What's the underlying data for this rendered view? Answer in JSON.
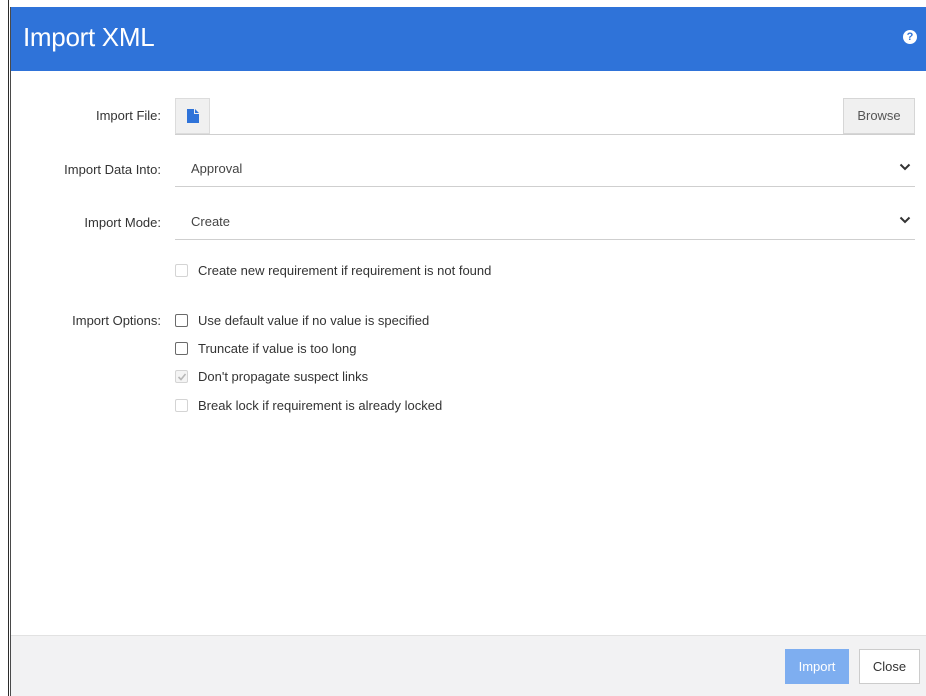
{
  "dialog": {
    "title": "Import XML",
    "help_icon": "question-circle-icon",
    "help_glyph": "?"
  },
  "colors": {
    "header_bg": "#2f73d9",
    "primary_button_disabled": "#7eaef0",
    "footer_bg": "#f2f2f3"
  },
  "form": {
    "import_file": {
      "label": "Import File:",
      "icon": "file-icon",
      "value": "",
      "browse_label": "Browse"
    },
    "import_data_into": {
      "label": "Import Data Into:",
      "value": "Approval"
    },
    "import_mode": {
      "label": "Import Mode:",
      "value": "Create"
    },
    "create_new_requirement": {
      "label": "Create new requirement if requirement is not found",
      "checked": false,
      "disabled": true
    },
    "import_options": {
      "label": "Import Options:",
      "options": [
        {
          "label": "Use default value if no value is specified",
          "checked": false,
          "disabled": false
        },
        {
          "label": "Truncate if value is too long",
          "checked": false,
          "disabled": false
        },
        {
          "label": "Don't propagate suspect links",
          "checked": true,
          "disabled": true
        },
        {
          "label": "Break lock if requirement is already locked",
          "checked": false,
          "disabled": true
        }
      ]
    }
  },
  "footer": {
    "import_label": "Import",
    "import_disabled": true,
    "close_label": "Close"
  }
}
